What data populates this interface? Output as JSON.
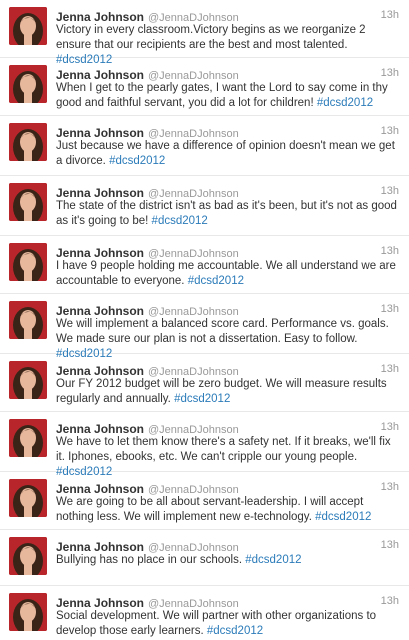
{
  "colors": {
    "hashtag": "#2b7bb9",
    "name": "#333333",
    "meta": "#999999"
  },
  "tweets": [
    {
      "name": "Jenna Johnson",
      "handle": "@JennaDJohnson",
      "time": "13h",
      "text": "Victory in every classroom.Victory begins as we reorganize 2 ensure that our recipients are the best and most talented.",
      "hashtag": "#dcsd2012"
    },
    {
      "name": "Jenna Johnson",
      "handle": "@JennaDJohnson",
      "time": "13h",
      "text": "When I get to the pearly gates, I want the Lord to say come in thy good and faithful servant, you did a lot for children!",
      "hashtag": "#dcsd2012"
    },
    {
      "name": "Jenna Johnson",
      "handle": "@JennaDJohnson",
      "time": "13h",
      "text": "Just because we have a difference of opinion doesn't mean we get a divorce.",
      "hashtag": "#dcsd2012"
    },
    {
      "name": "Jenna Johnson",
      "handle": "@JennaDJohnson",
      "time": "13h",
      "text": "The state of the district isn't as bad as it's been, but it's not as good as it's going to be!",
      "hashtag": "#dcsd2012"
    },
    {
      "name": "Jenna Johnson",
      "handle": "@JennaDJohnson",
      "time": "13h",
      "text": "I have 9 people holding me accountable. We all understand we are accountable to everyone.",
      "hashtag": "#dcsd2012"
    },
    {
      "name": "Jenna Johnson",
      "handle": "@JennaDJohnson",
      "time": "13h",
      "text": "We will implement a balanced score card. Performance vs. goals. We made sure our plan is not a dissertation. Easy to follow.",
      "hashtag": "#dcsd2012"
    },
    {
      "name": "Jenna Johnson",
      "handle": "@JennaDJohnson",
      "time": "13h",
      "text": "Our FY 2012 budget will be zero budget. We will measure results regularly and annually.",
      "hashtag": "#dcsd2012"
    },
    {
      "name": "Jenna Johnson",
      "handle": "@JennaDJohnson",
      "time": "13h",
      "text": "We have to let them know there's a safety net. If it breaks, we'll fix it. Iphones, ebooks, etc. We can't cripple our young people.",
      "hashtag": "#dcsd2012"
    },
    {
      "name": "Jenna Johnson",
      "handle": "@JennaDJohnson",
      "time": "13h",
      "text": "We are going to be all about servant-leadership. I will accept nothing less. We will implement new e-technology.",
      "hashtag": "#dcsd2012"
    },
    {
      "name": "Jenna Johnson",
      "handle": "@JennaDJohnson",
      "time": "13h",
      "text": "Bullying has no place in our schools.",
      "hashtag": "#dcsd2012"
    },
    {
      "name": "Jenna Johnson",
      "handle": "@JennaDJohnson",
      "time": "13h",
      "text": "Social development. We will partner with other organizations to develop those early learners.",
      "hashtag": "#dcsd2012"
    }
  ]
}
